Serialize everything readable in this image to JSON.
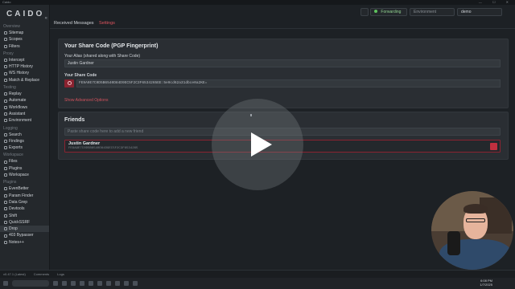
{
  "titlebar": {
    "title": "Caido",
    "controls": "— ☐ ✕"
  },
  "app": {
    "logo": "CAIDO",
    "collapse_icon": "«"
  },
  "sidebar": {
    "sections": [
      {
        "title": "Overview",
        "items": [
          "Sitemap",
          "Scopes",
          "Filters"
        ]
      },
      {
        "title": "Proxy",
        "items": [
          "Intercept",
          "HTTP History",
          "WS History",
          "Match & Replace"
        ]
      },
      {
        "title": "Testing",
        "items": [
          "Replay",
          "Automate",
          "Workflows",
          "Assistant",
          "Environment"
        ]
      },
      {
        "title": "Logging",
        "items": [
          "Search",
          "Findings",
          "Exports"
        ]
      },
      {
        "title": "Workspace",
        "items": [
          "Files",
          "Plugins",
          "Workspace"
        ]
      },
      {
        "title": "Plugins",
        "items": [
          "EvenBetter",
          "Param Finder",
          "Data Grep",
          "Devtools",
          "Shift",
          "QuickSSRF",
          "Drop",
          "403 Bypasser",
          "Notes++"
        ]
      }
    ],
    "active_item": "Drop"
  },
  "topbar": {
    "forwarding": "Forwarding",
    "environment": "Environment",
    "project": "demo"
  },
  "tabs": {
    "received": "Received Messages",
    "settings": "Settings"
  },
  "share": {
    "title": "Your Share Code (PGP Fingerprint)",
    "alias_label": "Your Alias (shared along with Share Code)",
    "alias_value": "Justin Gardner",
    "code_label": "Your Share Code",
    "code_value": "FE9A9E7C0D5B6540D84D9EC5F2C3F6534265EE:5e9cd62a31dbce0a2KE=",
    "advanced": "Show Advanced Options"
  },
  "friends": {
    "title": "Friends",
    "placeholder": "Paste share code here to add a new friend",
    "list": [
      {
        "name": "Justin Gardner",
        "fingerprint": "FE9A9E7C0D5B6540D84D9EC5F2C3F6534265"
      }
    ]
  },
  "statusbar": {
    "version": "v0.47.1 (Latest)",
    "comments": "Comments",
    "logs": "Logs"
  },
  "taskbar": {
    "time": "6:08 PM",
    "date": "1/7/2025"
  },
  "colors": {
    "accent": "#e0555f",
    "forwarding": "#5ec25e",
    "danger": "#c0303f"
  }
}
